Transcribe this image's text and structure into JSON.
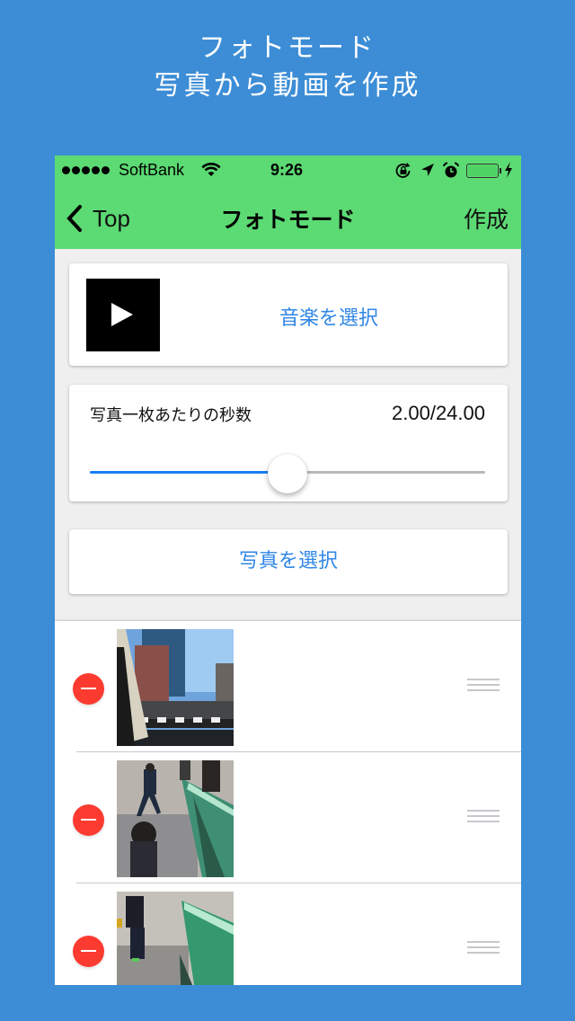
{
  "promo": {
    "line1": "フォトモード",
    "line2": "写真から動画を作成"
  },
  "status_bar": {
    "signal_dots": 5,
    "carrier": "SoftBank",
    "time": "9:26",
    "icons": [
      "wifi-icon",
      "rotation-lock-icon",
      "location-arrow-icon",
      "alarm-icon",
      "battery-icon",
      "charging-bolt-icon"
    ],
    "battery_level": 1.0
  },
  "nav": {
    "back_label": "Top",
    "title": "フォトモード",
    "action_label": "作成"
  },
  "music": {
    "select_label": "音楽を選択",
    "play_icon": "play-icon"
  },
  "slider": {
    "label": "写真一枚あたりの秒数",
    "value_text": "2.00/24.00",
    "fraction": 0.5
  },
  "photos": {
    "select_label": "写真を選択",
    "items": [
      {
        "description": "street intersection with buildings and crosswalk, blue sky"
      },
      {
        "description": "people walking beside green glass wall on sidewalk"
      },
      {
        "description": "person standing next to green glass wall on sidewalk"
      }
    ]
  },
  "colors": {
    "background": "#3c8dd6",
    "nav_green": "#5cda73",
    "link_blue": "#2f86e6",
    "slider_blue": "#1a7ff2",
    "delete_red": "#fc3b30"
  }
}
